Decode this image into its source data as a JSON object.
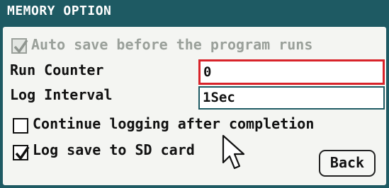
{
  "window": {
    "title": "MEMORY OPTION"
  },
  "options": {
    "auto_save": {
      "label": "Auto save before the program runs",
      "checked": true,
      "enabled": false
    },
    "continue_logging": {
      "label": "Continue logging after completion",
      "checked": false
    },
    "log_save_sd": {
      "label": "Log save to SD card",
      "checked": true
    }
  },
  "fields": {
    "run_counter": {
      "label": "Run Counter",
      "value": "0"
    },
    "log_interval": {
      "label": "Log Interval",
      "value": "1Sec"
    }
  },
  "buttons": {
    "back": "Back"
  },
  "icons": {
    "cursor": "mouse-pointer-icon",
    "check": "check-icon"
  },
  "colors": {
    "titlebar": "#1e5a63",
    "active_field_border": "#d8232a",
    "panel": "#f4f5f2"
  }
}
